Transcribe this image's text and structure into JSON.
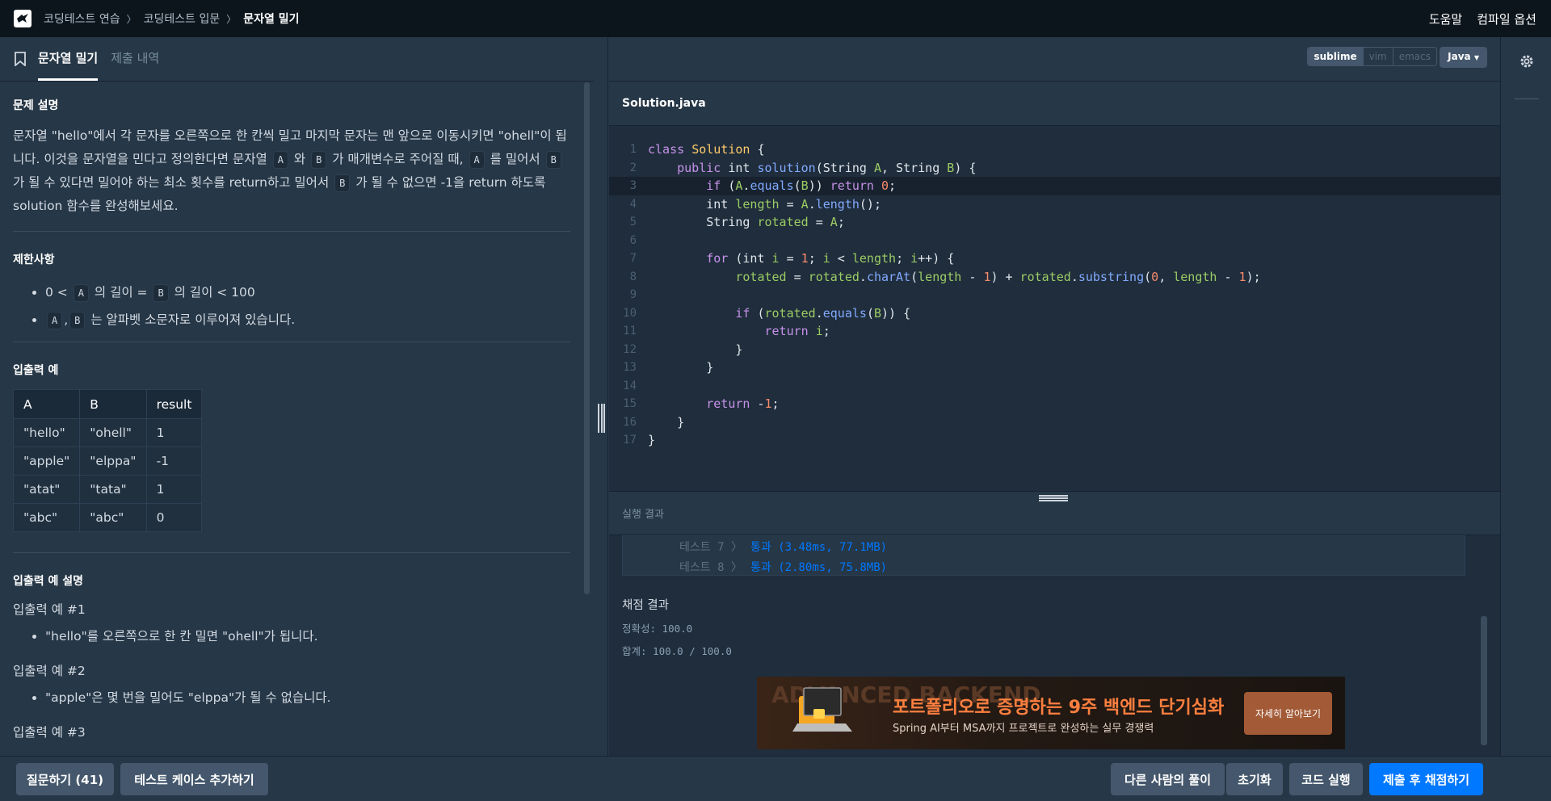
{
  "breadcrumbs": [
    "코딩테스트 연습",
    "코딩테스트 입문",
    "문자열 밀기"
  ],
  "header_links": [
    "도움말",
    "컴파일 옵션"
  ],
  "tabs": [
    "문자열 밀기",
    "제출 내역"
  ],
  "problem": {
    "desc_title": "문제 설명",
    "desc": {
      "p1": "문자열 \"hello\"에서 각 문자를 오른쪽으로 한 칸씩 밀고 마지막 문자는 맨 앞으로 이동시키면 \"ohell\"이 됩니다. 이것을 문자열을 민다고 정의한다면 문자열",
      "a": "A",
      "w1": "와",
      "b": "B",
      "p2": "가 매개변수로 주어질 때,",
      "p3": "를 밀어서",
      "p4": "가 될 수 있다면 밀어야 하는 최소 횟수를 return하고 밀어서",
      "p5": "가 될 수 없으면 -1을 return 하도록 solution 함수를 완성해보세요."
    },
    "limits_title": "제한사항",
    "limit1": {
      "pre": "0 <",
      "mid": "의 길이 =",
      "post": "의 길이 < 100"
    },
    "limit2": {
      "sep": ",",
      "post": "는 알파벳 소문자로 이루어져 있습니다."
    },
    "io_title": "입출력 예",
    "io_headers": [
      "A",
      "B",
      "result"
    ],
    "io_rows": [
      [
        "\"hello\"",
        "\"ohell\"",
        "1"
      ],
      [
        "\"apple\"",
        "\"elppa\"",
        "-1"
      ],
      [
        "\"atat\"",
        "\"tata\"",
        "1"
      ],
      [
        "\"abc\"",
        "\"abc\"",
        "0"
      ]
    ],
    "io_desc_title": "입출력 예 설명",
    "ex1_title": "입출력 예 #1",
    "ex1_item": "\"hello\"를 오른쪽으로 한 칸 밀면 \"ohell\"가 됩니다.",
    "ex2_title": "입출력 예 #2",
    "ex2_item": "\"apple\"은 몇 번을 밀어도 \"elppa\"가 될 수 없습니다.",
    "ex3_title": "입출력 예 #3"
  },
  "editor": {
    "modes": [
      "sublime",
      "vim",
      "emacs"
    ],
    "language": "Java",
    "filename": "Solution.java",
    "line_numbers": [
      "1",
      "2",
      "3",
      "4",
      "5",
      "6",
      "7",
      "8",
      "9",
      "10",
      "11",
      "12",
      "13",
      "14",
      "15",
      "16",
      "17"
    ]
  },
  "results": {
    "title": "실행 결과",
    "tests": [
      {
        "name": "테스트 7 〉",
        "result": "통과 (3.48ms, 77.1MB)"
      },
      {
        "name": "테스트 8 〉",
        "result": "통과 (2.80ms, 75.8MB)"
      }
    ],
    "grade_title": "채점 결과",
    "accuracy": "정확성: 100.0",
    "total": "합계: 100.0 / 100.0"
  },
  "ad": {
    "bg_text": "ADVANCED BACKEND",
    "title": "포트폴리오로 증명하는 9주 백엔드 단기심화",
    "subtitle": "Spring AI부터 MSA까지 프로젝트로 완성하는 실무 경쟁력",
    "button": "자세히 알아보기"
  },
  "bottom": {
    "ask": "질문하기 (41)",
    "add_test": "테스트 케이스 추가하기",
    "others": "다른 사람의 풀이",
    "reset": "초기화",
    "run": "코드 실행",
    "submit": "제출 후 채점하기"
  },
  "colors": {
    "primary": "#0078ff",
    "background": "#263747",
    "topbar": "#0c151c"
  }
}
